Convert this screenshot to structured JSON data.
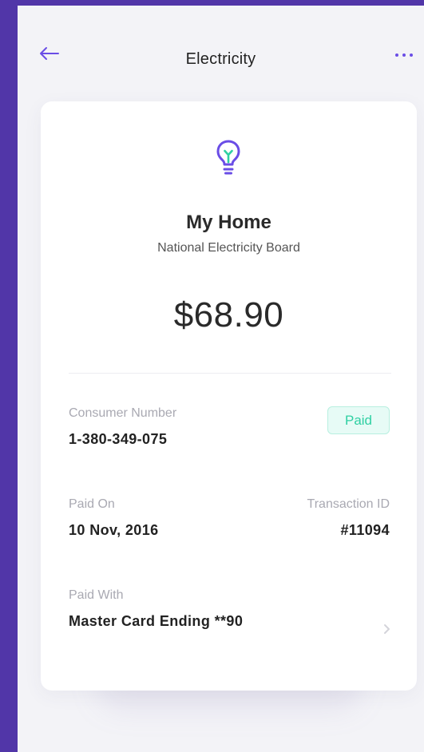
{
  "header": {
    "title": "Electricity",
    "back_icon": "arrow-left-icon",
    "more_icon": "more-horizontal-icon"
  },
  "card": {
    "icon": "lightbulb-icon",
    "name": "My Home",
    "provider": "National Electricity Board",
    "amount": "$68.90",
    "consumer_label": "Consumer Number",
    "consumer_number": "1-380-349-075",
    "status": "Paid",
    "paid_on_label": "Paid On",
    "paid_on": "10 Nov, 2016",
    "transaction_label": "Transaction ID",
    "transaction_id": "#11094",
    "paid_with_label": "Paid With",
    "paid_with": "Master Card Ending **90"
  },
  "colors": {
    "background": "#5136a8",
    "accent": "#6a4de6",
    "bulb_teal": "#2fd0a3",
    "status_green": "#2fd0a3"
  }
}
